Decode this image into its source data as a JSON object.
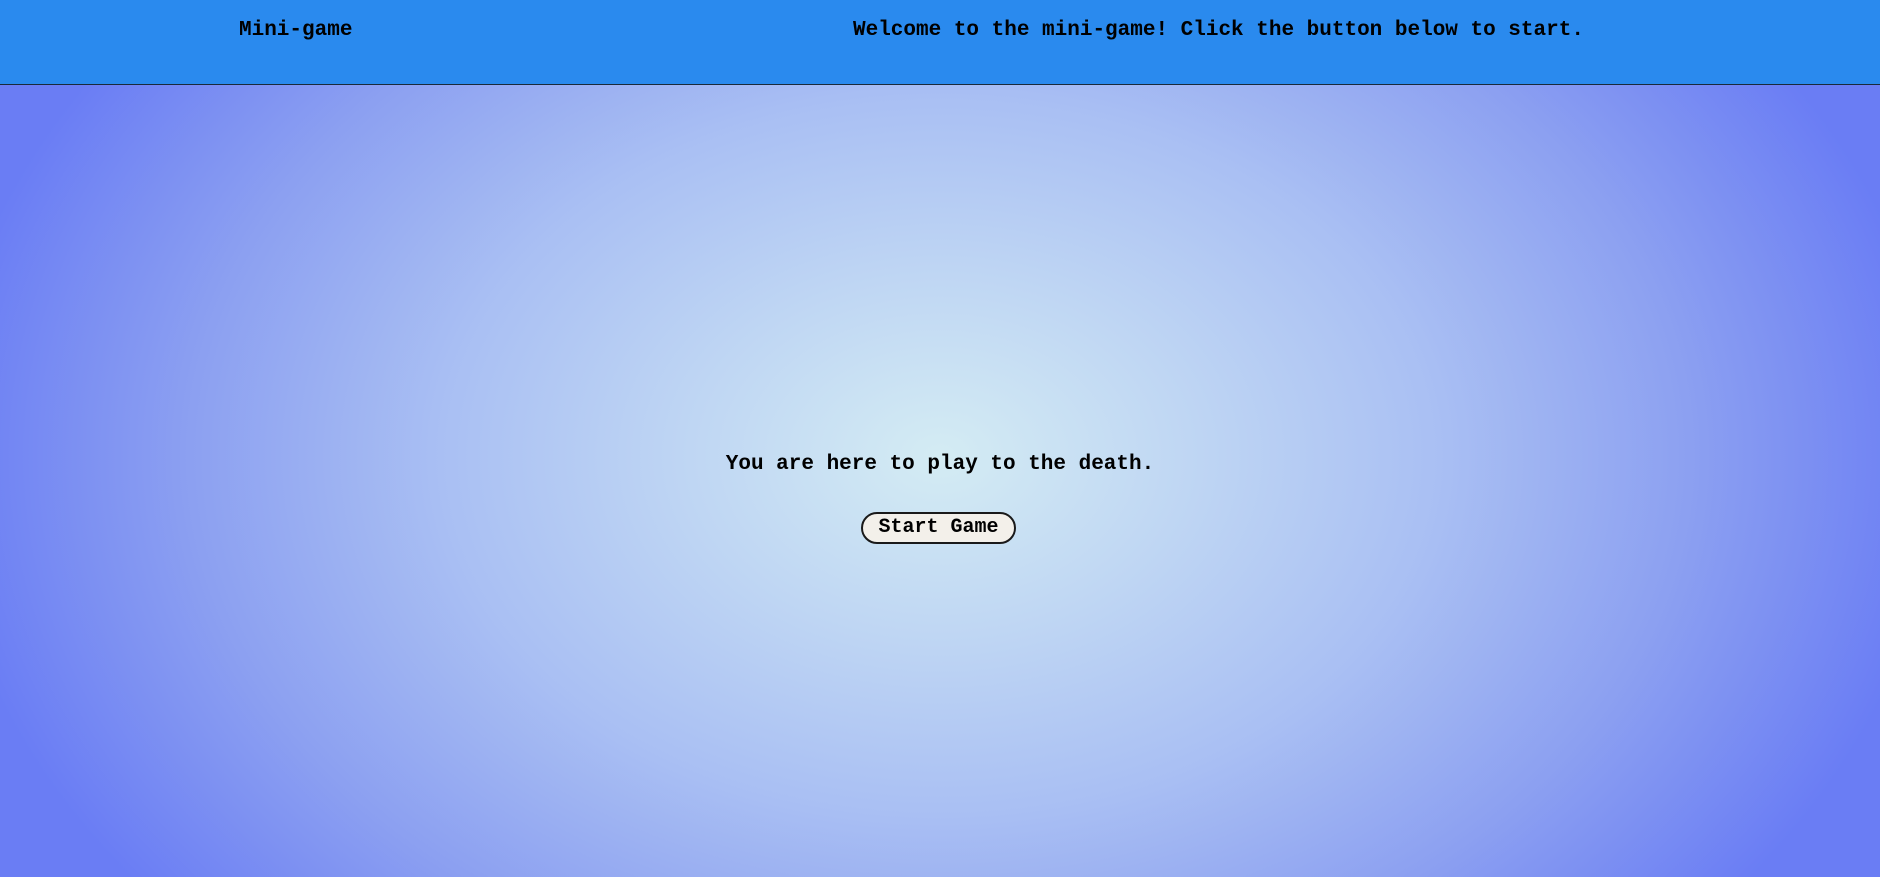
{
  "header": {
    "title": "Mini-game",
    "welcome": "Welcome to the mini-game! Click the button below to start."
  },
  "main": {
    "tagline": "You are here to play to the death.",
    "start_button_label": "Start Game"
  },
  "colors": {
    "header_background": "#2a8aee",
    "background_center": "#d4ecf3",
    "background_edge": "#6a7df4",
    "button_background": "#f3f0ea"
  }
}
